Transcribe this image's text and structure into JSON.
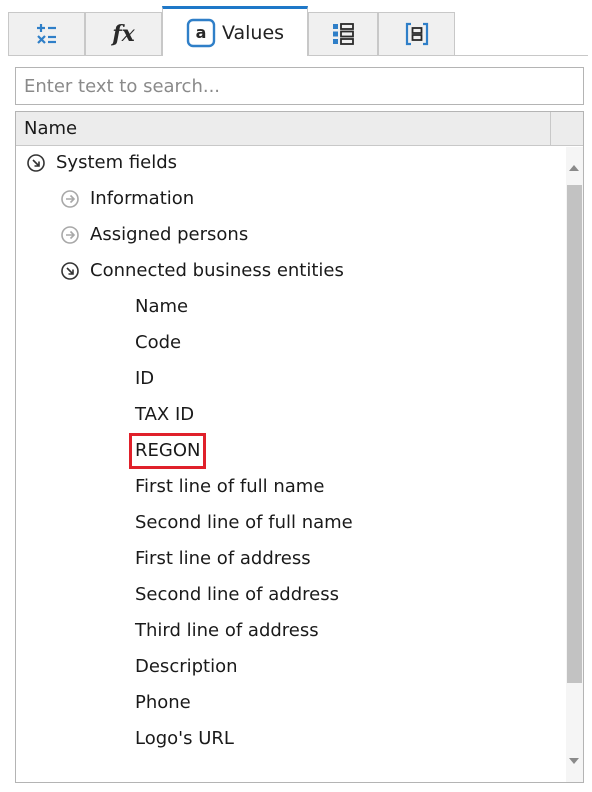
{
  "tabs": [
    {
      "id": "operators",
      "icon": "operators-icon",
      "label": ""
    },
    {
      "id": "functions",
      "icon": "fx-icon",
      "label": "fx"
    },
    {
      "id": "values",
      "icon": "at-value-icon",
      "label": "Values",
      "active": true
    },
    {
      "id": "list",
      "icon": "numbered-list-icon",
      "label": ""
    },
    {
      "id": "brackets",
      "icon": "bracket-field-icon",
      "label": ""
    }
  ],
  "search": {
    "placeholder": "Enter text to search...",
    "value": ""
  },
  "grid": {
    "column_header": "Name"
  },
  "tree": [
    {
      "label": "System fields",
      "level": 0,
      "icon": "expanded-arrow-icon"
    },
    {
      "label": "Information",
      "level": 1,
      "icon": "collapsed-arrow-icon"
    },
    {
      "label": "Assigned persons",
      "level": 1,
      "icon": "collapsed-arrow-icon"
    },
    {
      "label": "Connected business entities",
      "level": 1,
      "icon": "expanded-arrow-icon"
    },
    {
      "label": "Name",
      "level": 2
    },
    {
      "label": "Code",
      "level": 2
    },
    {
      "label": "ID",
      "level": 2
    },
    {
      "label": "TAX ID",
      "level": 2
    },
    {
      "label": "REGON",
      "level": 2,
      "highlighted": true
    },
    {
      "label": "First line of full name",
      "level": 2
    },
    {
      "label": "Second line of full name",
      "level": 2
    },
    {
      "label": "First line of address",
      "level": 2
    },
    {
      "label": "Second line of address",
      "level": 2
    },
    {
      "label": "Third line of address",
      "level": 2
    },
    {
      "label": "Description",
      "level": 2
    },
    {
      "label": "Phone",
      "level": 2
    },
    {
      "label": "Logo's URL",
      "level": 2
    }
  ],
  "colors": {
    "accent": "#1e78c8",
    "highlight": "#e0202a"
  }
}
